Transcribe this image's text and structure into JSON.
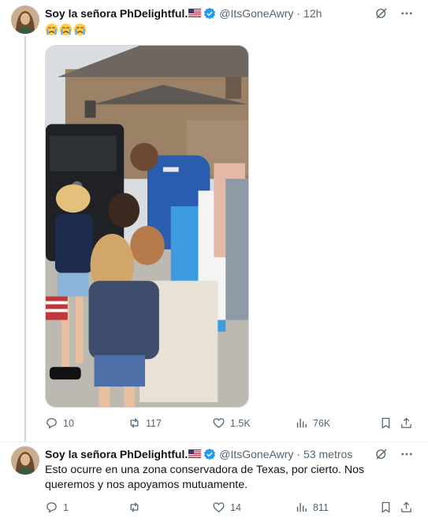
{
  "tweet1": {
    "display_name": "Soy la señora PhDelightful.",
    "handle": "@ItsGoneAwry",
    "separator": "·",
    "time": "12h",
    "text_emojis": [
      "crying-face",
      "crying-face",
      "crying-face"
    ],
    "stats": {
      "replies": "10",
      "reposts": "117",
      "likes": "1.5K",
      "views": "76K"
    }
  },
  "tweet2": {
    "display_name": "Soy la señora PhDelightful.",
    "handle": "@ItsGoneAwry",
    "separator": "·",
    "time": "53 metros",
    "text": "Esto ocurre en una zona conservadora de Texas, por cierto. Nos queremos y nos apoyamos mutuamente.",
    "stats": {
      "replies": "1",
      "reposts": "",
      "likes": "14",
      "views": "811"
    }
  },
  "colors": {
    "text_primary": "#0f1419",
    "text_secondary": "#536471",
    "verified_blue": "#1d9bf0",
    "thread_line": "#cfd9de"
  },
  "icons": [
    "grok-icon",
    "more-icon",
    "reply-icon",
    "repost-icon",
    "like-icon",
    "views-icon",
    "bookmark-icon",
    "share-icon",
    "verified-badge-icon",
    "us-flag-icon"
  ]
}
